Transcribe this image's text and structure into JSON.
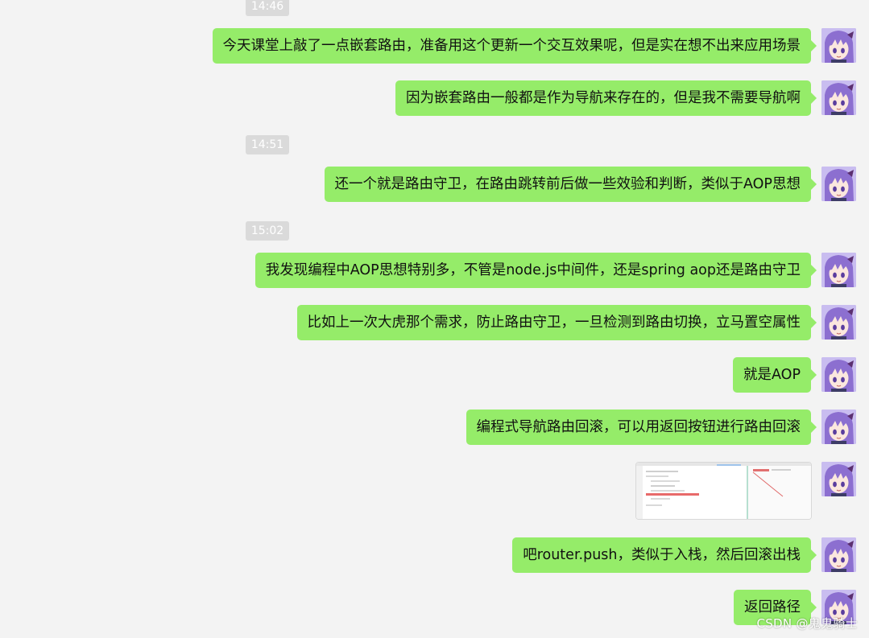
{
  "timestamps": [
    "14:46",
    "14:51",
    "15:02"
  ],
  "messages": [
    "今天课堂上敲了一点嵌套路由，准备用这个更新一个交互效果呢，但是实在想不出来应用场景",
    "因为嵌套路由一般都是作为导航来存在的，但是我不需要导航啊",
    "还一个就是路由守卫，在路由跳转前后做一些效验和判断，类似于AOP思想",
    "我发现编程中AOP思想特别多，不管是node.js中间件，还是spring aop还是路由守卫",
    "比如上一次大虎那个需求，防止路由守卫，一旦检测到路由切换，立马置空属性",
    "就是AOP",
    "编程式导航路由回滚，可以用返回按钮进行路由回滚",
    "吧router.push，类似于入栈，然后回滚出栈",
    "返回路径"
  ],
  "image_message": {
    "kind": "screenshot-thumbnail"
  },
  "avatar": {
    "icon": "anime-girl-avatar-icon"
  },
  "colors": {
    "background": "#f3f3f3",
    "bubble": "#95ec69",
    "timestamp_bg": "#dadada",
    "avatar_hair": "#8c6fd0"
  },
  "watermark": "CSDN @鬼鬼骑士"
}
